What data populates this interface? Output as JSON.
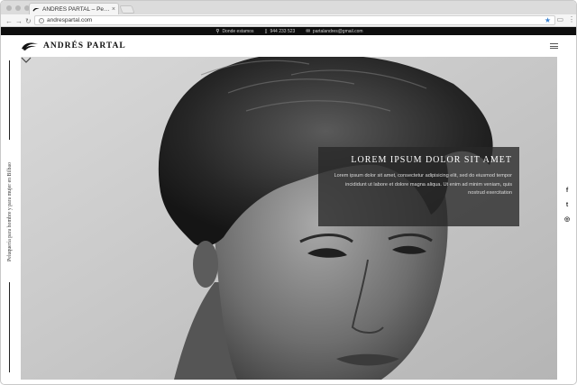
{
  "browser": {
    "tab_title": "ANDRÉS PARTAL – Peluquería",
    "tab_close": "×",
    "url": "andrespartal.com",
    "back_icon": "back-arrow-icon",
    "forward_icon": "forward-arrow-icon",
    "reload_icon": "reload-icon",
    "star_icon": "bookmark-star-icon"
  },
  "topbar": {
    "location_label": "Donde estamos",
    "phone": "944 233 523",
    "email": "partalandres@gmail.com"
  },
  "header": {
    "logo_text": "ANDRÉS PARTAL"
  },
  "sidebar": {
    "tagline": "Peluquería para hombre y para mujer en Bilbao"
  },
  "hero": {
    "title": "LOREM IPSUM DOLOR SIT AMET",
    "body": "Lorem ipsum dolor sit amet, consectetur adipisicing elit, sed do eiusmod tempor incididunt ut labore et dolore magna aliqua. Ut enim ad minim veniam, quis nostrud exercitation"
  },
  "social": {
    "facebook": "f",
    "twitter": "t",
    "instagram": "◎"
  },
  "colors": {
    "topbar_bg": "#0e0e0e",
    "overlay_bg": "#282828",
    "accent_star": "#3b82d0"
  }
}
